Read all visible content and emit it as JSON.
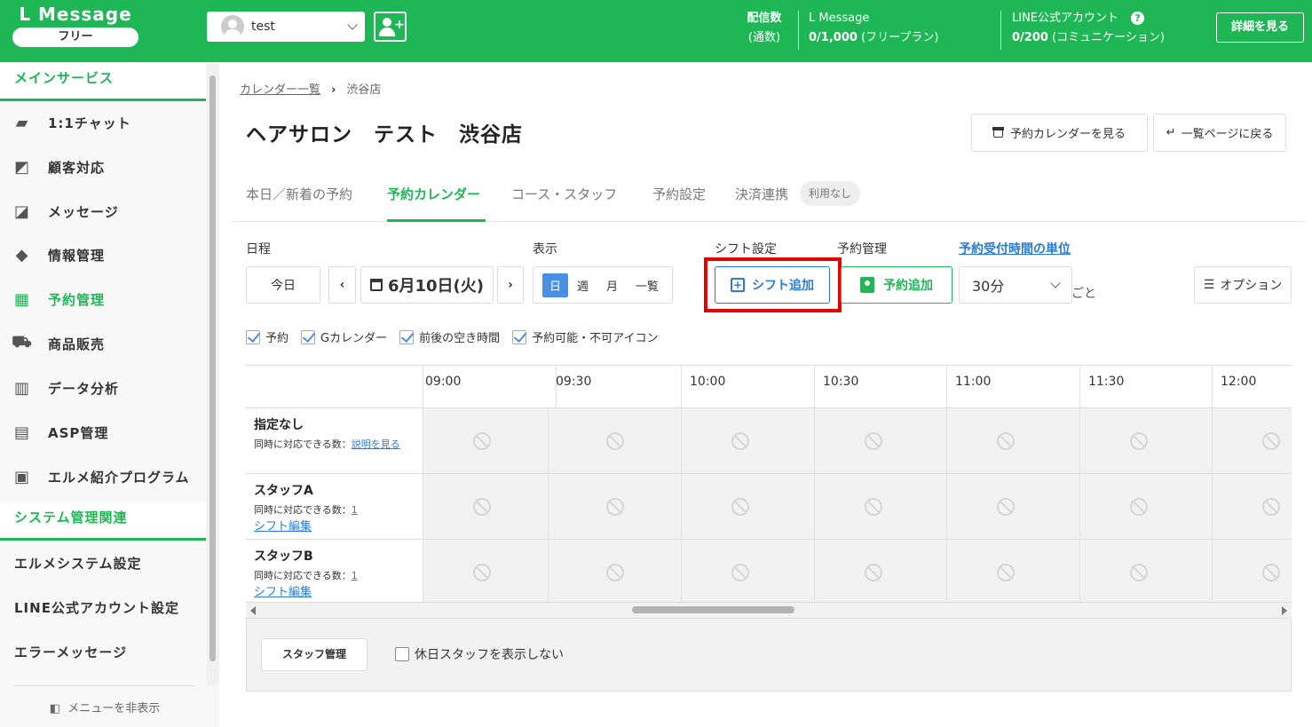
{
  "header": {
    "logo": "L Message",
    "plan": "フリー",
    "account": "test",
    "stats": [
      {
        "label": "配信数",
        "sub": "(通数)"
      },
      {
        "label": "L Message",
        "value": "0/1,000",
        "note": "(フリープラン)"
      },
      {
        "label": "LINE公式アカウント",
        "value": "0/200",
        "note": "(コミュニケーション)"
      }
    ],
    "detail_button": "詳細を見る"
  },
  "sidebar": {
    "section_main": "メインサービス",
    "items": [
      {
        "label": "1:1チャット",
        "icon": "chat-icon"
      },
      {
        "label": "顧客対応",
        "icon": "arrow-box-icon"
      },
      {
        "label": "メッセージ",
        "icon": "message-icon"
      },
      {
        "label": "情報管理",
        "icon": "tag-icon"
      },
      {
        "label": "予約管理",
        "icon": "calendar-icon",
        "active": true
      },
      {
        "label": "商品販売",
        "icon": "cart-icon"
      },
      {
        "label": "データ分析",
        "icon": "bar-chart-icon"
      },
      {
        "label": "ASP管理",
        "icon": "asp-icon"
      },
      {
        "label": "エルメ紹介プログラム",
        "icon": "clipboard-icon"
      }
    ],
    "section_system": "システム管理関連",
    "system_items": [
      "エルメシステム設定",
      "LINE公式アカウント設定",
      "エラーメッセージ"
    ],
    "hide_menu": "メニューを非表示"
  },
  "breadcrumb": {
    "link": "カレンダー一覧",
    "current": "渋谷店"
  },
  "page_title": "ヘアサロン　テスト　渋谷店",
  "top_buttons": {
    "calendar": "予約カレンダーを見る",
    "back": "一覧ページに戻る"
  },
  "tabs": [
    "本日／新着の予約",
    "予約カレンダー",
    "コース・スタッフ",
    "予約設定",
    "決済連携"
  ],
  "tab_badge": "利用なし",
  "controls": {
    "schedule_label": "日程",
    "today": "今日",
    "date": "6月10日(火)",
    "display_label": "表示",
    "views": [
      "日",
      "週",
      "月",
      "一覧"
    ],
    "shift_label": "シフト設定",
    "shift_add": "シフト追加",
    "resv_label": "予約管理",
    "resv_add": "予約追加",
    "unit_label": "予約受付時間の単位",
    "unit_value": "30分",
    "unit_suffix": "ごと",
    "option": "オプション"
  },
  "checkboxes": [
    "予約",
    "Gカレンダー",
    "前後の空き時間",
    "予約可能・不可アイコン"
  ],
  "times": [
    "09:00",
    "09:30",
    "10:00",
    "10:30",
    "11:00",
    "11:30",
    "12:00"
  ],
  "rows": [
    {
      "name": "指定なし",
      "capacity_label": "同時に対応できる数：",
      "capacity": "説明を見る",
      "edit": ""
    },
    {
      "name": "スタッフA",
      "capacity_label": "同時に対応できる数：",
      "capacity": "1",
      "edit": "シフト編集"
    },
    {
      "name": "スタッフB",
      "capacity_label": "同時に対応できる数：",
      "capacity": "1",
      "edit": "シフト編集"
    }
  ],
  "footer": {
    "staff_button": "スタッフ管理",
    "hide_holiday": "休日スタッフを表示しない"
  },
  "colors": {
    "brand": "#1fb655",
    "link": "#2a7bd4",
    "highlight": "#e30000"
  }
}
